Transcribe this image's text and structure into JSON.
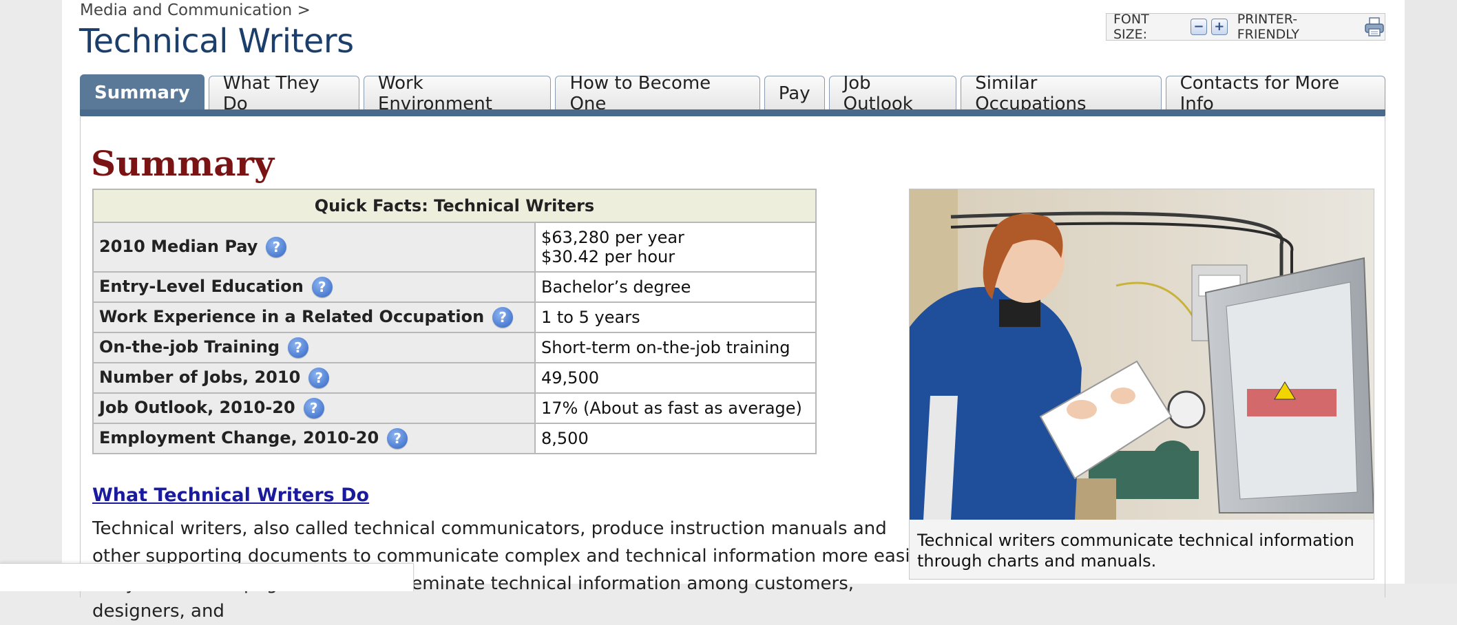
{
  "breadcrumb": "Media and Communication >",
  "title": "Technical Writers",
  "tools": {
    "font_size_label": "FONT SIZE:",
    "decrease": "−",
    "increase": "+",
    "printer_label": "PRINTER-FRIENDLY"
  },
  "tabs": [
    {
      "label": "Summary",
      "active": true
    },
    {
      "label": "What They Do"
    },
    {
      "label": "Work Environment"
    },
    {
      "label": "How to Become One"
    },
    {
      "label": "Pay"
    },
    {
      "label": "Job Outlook"
    },
    {
      "label": "Similar Occupations"
    },
    {
      "label": "Contacts for More Info"
    }
  ],
  "summary": {
    "heading": "Summary",
    "table_title": "Quick Facts: Technical Writers",
    "rows": [
      {
        "key": "2010 Median Pay",
        "value": "$63,280 per year",
        "value2": "$30.42 per hour"
      },
      {
        "key": "Entry-Level Education",
        "value": "Bachelor’s degree"
      },
      {
        "key": "Work Experience in a Related Occupation",
        "value": "1 to 5 years"
      },
      {
        "key": "On-the-job Training",
        "value": "Short-term on-the-job training"
      },
      {
        "key": "Number of Jobs, 2010",
        "value": "49,500"
      },
      {
        "key": "Job Outlook, 2010-20",
        "value": "17% (About as fast as average)"
      },
      {
        "key": "Employment Change, 2010-20",
        "value": "8,500"
      }
    ],
    "help_glyph": "?"
  },
  "section": {
    "link": "What Technical Writers Do",
    "paragraph": "Technical writers, also called technical communicators, produce instruction manuals and other supporting documents to communicate complex and technical information more easily. They also develop, gather, and disseminate technical information among customers, designers, and"
  },
  "photo_caption": "Technical writers communicate technical information through charts and manuals.",
  "colors": {
    "title": "#1c3e6b",
    "summary_heading": "#7a1414",
    "tab_active": "#5a7898",
    "link": "#1a1a9e"
  }
}
